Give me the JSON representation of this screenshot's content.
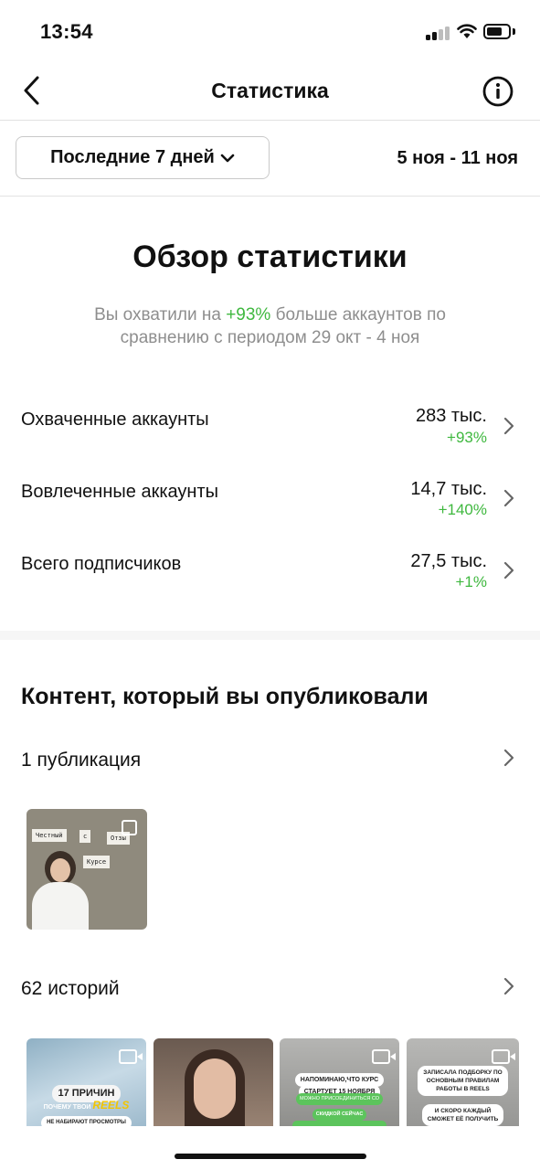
{
  "status_bar": {
    "time": "13:54"
  },
  "header": {
    "title": "Статистика",
    "back_icon": "chevron-left-icon",
    "info_icon": "info-icon"
  },
  "period": {
    "label": "Последние 7 дней",
    "range": "5 ноя - 11 ноя"
  },
  "overview": {
    "title": "Обзор статистики",
    "summary_prefix": "Вы охватили на ",
    "summary_highlight": "+93%",
    "summary_suffix": " больше аккаунтов по сравнению с периодом 29 окт - 4 ноя",
    "metrics": [
      {
        "label": "Охваченные аккаунты",
        "value": "283 тыс.",
        "change": "+93%"
      },
      {
        "label": "Вовлеченные аккаунты",
        "value": "14,7 тыс.",
        "change": "+140%"
      },
      {
        "label": "Всего подписчиков",
        "value": "27,5 тыс.",
        "change": "+1%"
      }
    ]
  },
  "content": {
    "title": "Контент, который вы опубликовали",
    "publications_label": "1 публикация",
    "post": {
      "notes": [
        "Честный",
        "с",
        "Отзы",
        "Курсе"
      ]
    },
    "stories_label": "62 историй",
    "stories": [
      {
        "line1": "17 ПРИЧИН",
        "line2": "ПОЧЕМУ ТВОИ",
        "line3": "REELS",
        "line4": "НЕ НАБИРАЮТ ПРОСМОТРЫ"
      },
      {},
      {
        "line1": "НАПОМИНАЮ,ЧТО КУРС",
        "line2": "СТАРТУЕТ 15 НОЯБРЯ",
        "line3": "МОЖНО ПРИСОЕДИНИТЬСЯ СО",
        "line4": "СКИДКОЙ СЕЙЧАС"
      },
      {
        "line1": "ЗАПИСАЛА ПОДБОРКУ ПО",
        "line2": "ОСНОВНЫМ ПРАВИЛАМ",
        "line3": "РАБОТЫ В REELS",
        "line4": "И СКОРО КАЖДЫЙ",
        "line5": "СМОЖЕТ ЕЁ ПОЛУЧИТЬ"
      }
    ]
  },
  "colors": {
    "positive": "#3fb83f",
    "muted": "#8e8e8e"
  }
}
